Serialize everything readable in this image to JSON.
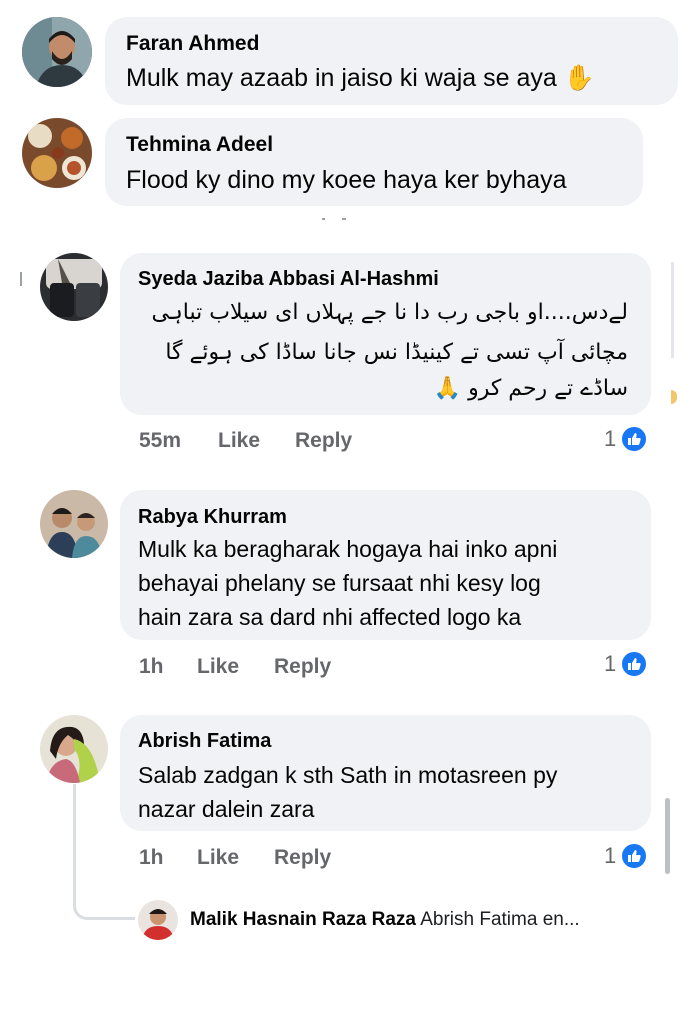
{
  "comments": [
    {
      "author": "Faran Ahmed",
      "text": "Mulk may azaab in jaiso ki waja se aya",
      "emoji": "✋"
    },
    {
      "author": "Tehmina Adeel",
      "text": "Flood ky dino my koee haya ker byhaya"
    },
    {
      "author": "Syeda Jaziba Abbasi Al-Hashmi",
      "lines": [
        "لےدس....او باجی رب دا نا جے پہلاں ای سیلاب تباہی",
        "مچائی آپ تسی تے کینیڈا نس جانا ساڈا کی ہوئے گا",
        "ساڈے تے رحم کرو"
      ],
      "emoji": "🙏",
      "time": "55m",
      "like_label": "Like",
      "reply_label": "Reply",
      "like_count": "1"
    },
    {
      "author": "Rabya Khurram",
      "lines": [
        "Mulk ka beragharak hogaya hai inko apni",
        "behayai phelany se fursaat nhi kesy log",
        "hain zara sa dard nhi affected logo ka"
      ],
      "time": "1h",
      "like_label": "Like",
      "reply_label": "Reply",
      "like_count": "1"
    },
    {
      "author": "Abrish Fatima",
      "lines": [
        "Salab zadgan k sth Sath in motasreen py",
        "nazar dalein zara"
      ],
      "time": "1h",
      "like_label": "Like",
      "reply_label": "Reply",
      "like_count": "1"
    }
  ],
  "reply_preview": {
    "author": "Malik Hasnain Raza Raza",
    "text": "Abrish Fatima en..."
  },
  "colors": {
    "bubble": "#f0f2f5",
    "meta_text": "#65676b",
    "like_blue": "#1877f2"
  },
  "icons": {
    "like_badge": "thumbs-up-icon"
  }
}
